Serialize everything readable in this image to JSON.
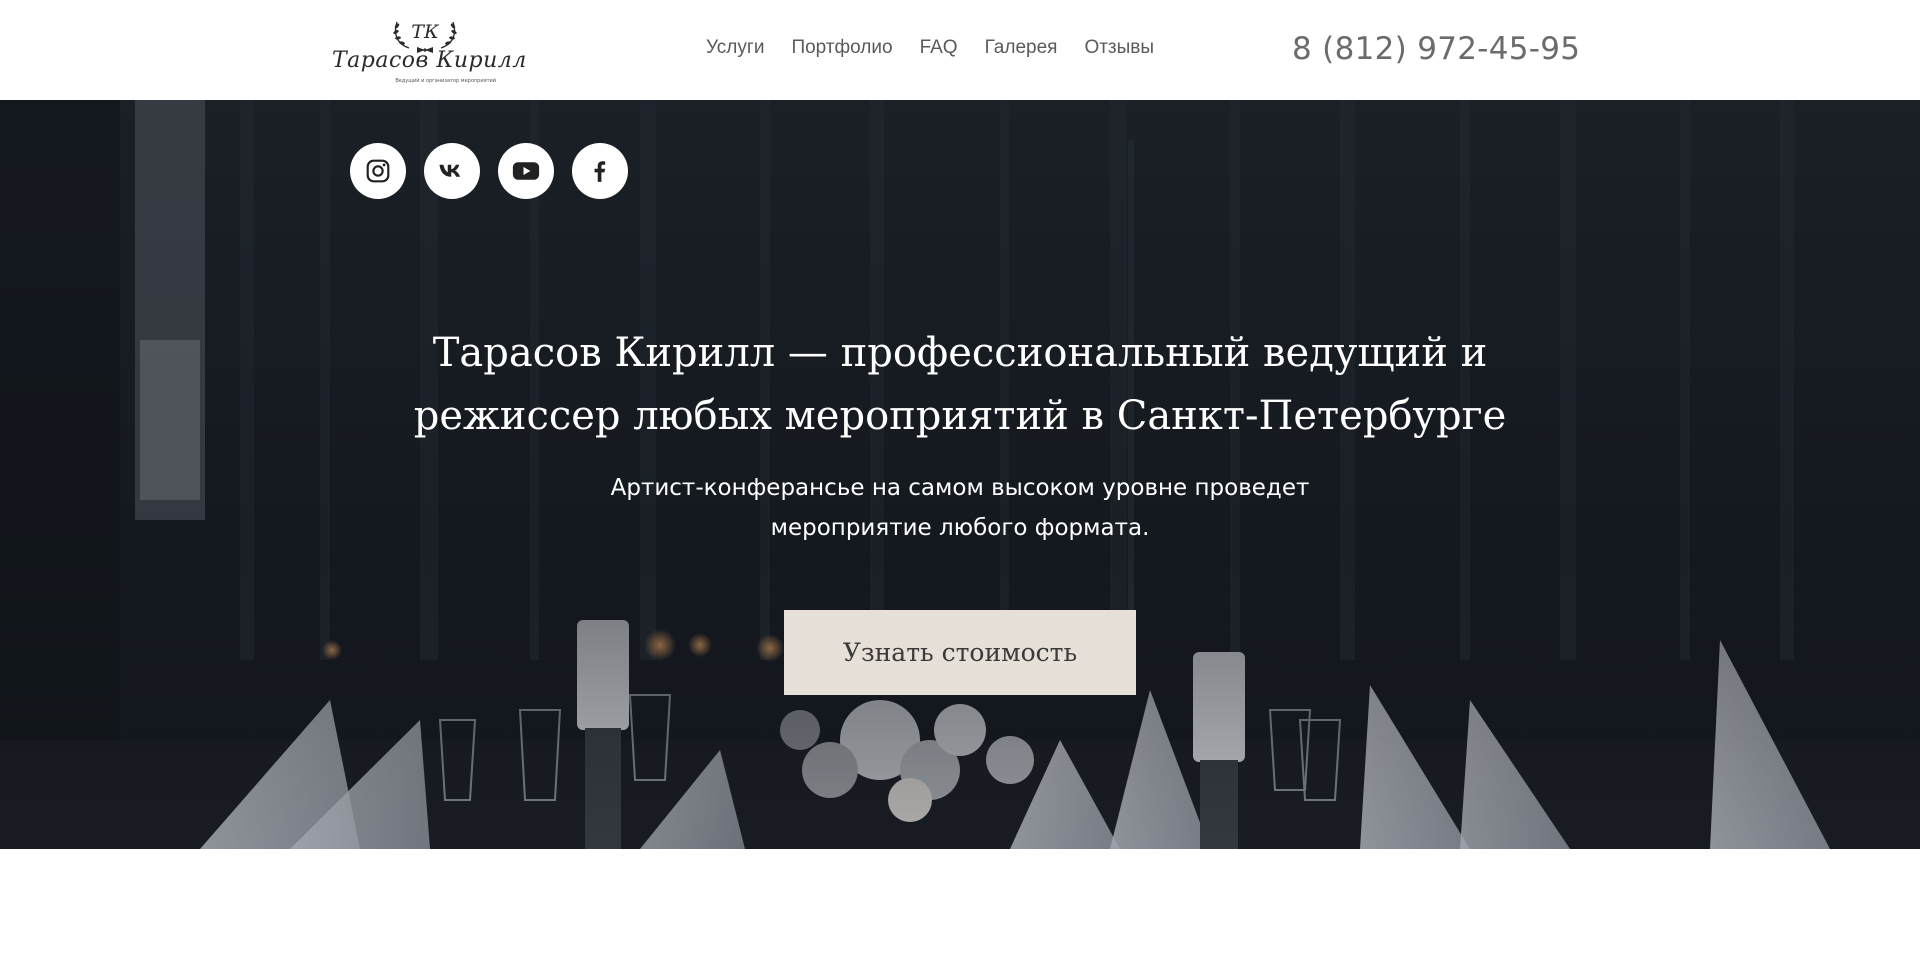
{
  "header": {
    "logo": {
      "monogram": "ТК",
      "name": "Тарасов Кирилл",
      "tagline": "Ведущий и организатор мероприятий"
    },
    "nav": [
      {
        "label": "Услуги"
      },
      {
        "label": "Портфолио"
      },
      {
        "label": "FAQ"
      },
      {
        "label": "Галерея"
      },
      {
        "label": "Отзывы"
      }
    ],
    "phone": "8 (812) 972-45-95"
  },
  "hero": {
    "socials": [
      {
        "icon": "instagram-icon"
      },
      {
        "icon": "vk-icon"
      },
      {
        "icon": "youtube-icon"
      },
      {
        "icon": "facebook-icon"
      }
    ],
    "title": "Тарасов Кирилл — профессиональный ведущий и режиссер любых мероприятий в Санкт-Петербурге",
    "subtitle": "Артист-конферансье на самом высоком уровне проведет мероприятие любого формата.",
    "cta_label": "Узнать стоимость"
  },
  "colors": {
    "nav_text": "#5a5a5a",
    "phone_text": "#6b6b6b",
    "hero_overlay": "#1d2228",
    "cta_background": "#e6e0d8",
    "cta_text": "#3a3a3a"
  }
}
